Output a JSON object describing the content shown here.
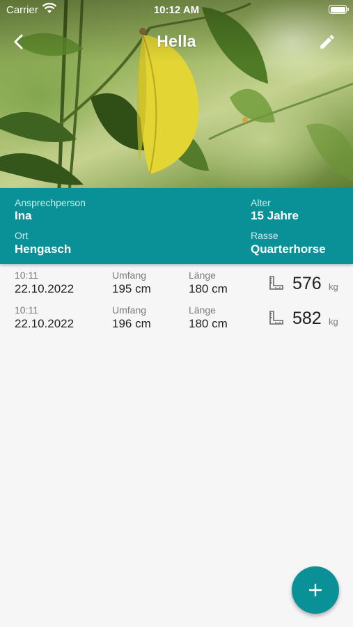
{
  "status_bar": {
    "carrier": "Carrier",
    "time": "10:12 AM",
    "icons": [
      "wifi-icon",
      "battery-icon"
    ]
  },
  "nav": {
    "title": "Hella",
    "back_icon": "chevron-left-icon",
    "edit_icon": "pencil-icon"
  },
  "info": {
    "contact_label": "Ansprechperson",
    "contact_value": "Ina",
    "age_label": "Alter",
    "age_value": "15 Jahre",
    "location_label": "Ort",
    "location_value": "Hengasch",
    "breed_label": "Rasse",
    "breed_value": "Quarterhorse",
    "panel_color": "#0a9198"
  },
  "measurements": [
    {
      "time": "10:11",
      "date": "22.10.2022",
      "girth_label": "Umfang",
      "girth_value": "195 cm",
      "length_label": "Länge",
      "length_value": "180 cm",
      "weight": "576",
      "unit": "kg",
      "icon": "ruler-icon"
    },
    {
      "time": "10:11",
      "date": "22.10.2022",
      "girth_label": "Umfang",
      "girth_value": "196 cm",
      "length_label": "Länge",
      "length_value": "180 cm",
      "weight": "582",
      "unit": "kg",
      "icon": "ruler-icon"
    }
  ],
  "fab": {
    "icon": "plus-icon",
    "color": "#0a9198"
  }
}
